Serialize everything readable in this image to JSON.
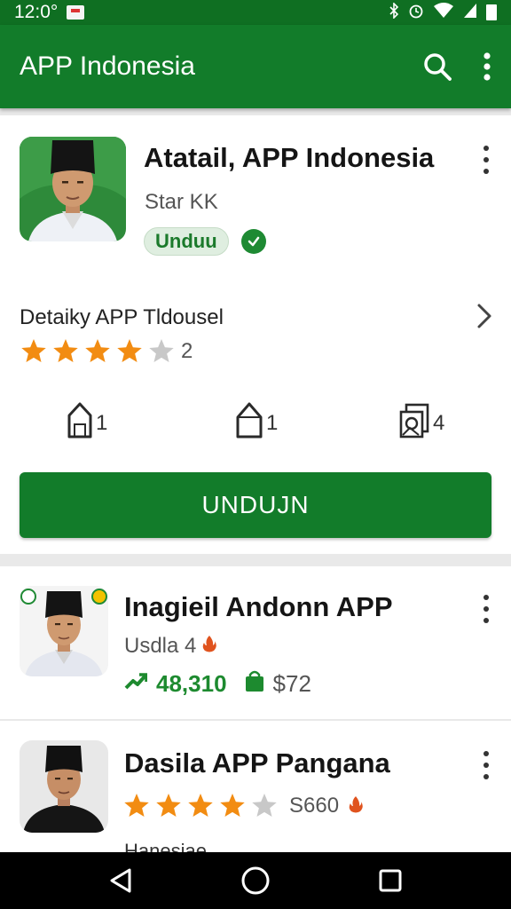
{
  "status_bar": {
    "time": "12:0°",
    "icons": [
      "bluetooth-icon",
      "alarm-icon",
      "wifi-icon",
      "signal-icon",
      "battery-icon"
    ]
  },
  "app_bar": {
    "title": "APP Indonesia",
    "icons": [
      "search-icon",
      "more-vert-icon"
    ]
  },
  "featured": {
    "name": "Atatail, APP Indonesia",
    "developer": "Star KK",
    "chip_label": "Unduu",
    "details_label": "Detaiky APP Tldousel",
    "rating": 4,
    "rating_max": 5,
    "rating_count": "2",
    "stats": [
      {
        "icon": "house-icon",
        "value": "1"
      },
      {
        "icon": "house-icon",
        "value": "1"
      },
      {
        "icon": "gallery-icon",
        "value": "4"
      }
    ],
    "install_label": "UNDUJN"
  },
  "list": [
    {
      "name": "Inagieil Andonn APP",
      "subtitle": "Usdla 4",
      "downloads": "48,310",
      "price": "$72"
    },
    {
      "name": "Dasila APP Pangana",
      "rating": 4,
      "rating_max": 5,
      "price": "S660",
      "partial_text": "Hanesiae"
    }
  ],
  "colors": {
    "primary": "#127c2a",
    "status_bar": "#0f6f22",
    "star": "#f28c12",
    "star_empty": "#c8c8c8",
    "accent_green": "#1d8a2f"
  }
}
